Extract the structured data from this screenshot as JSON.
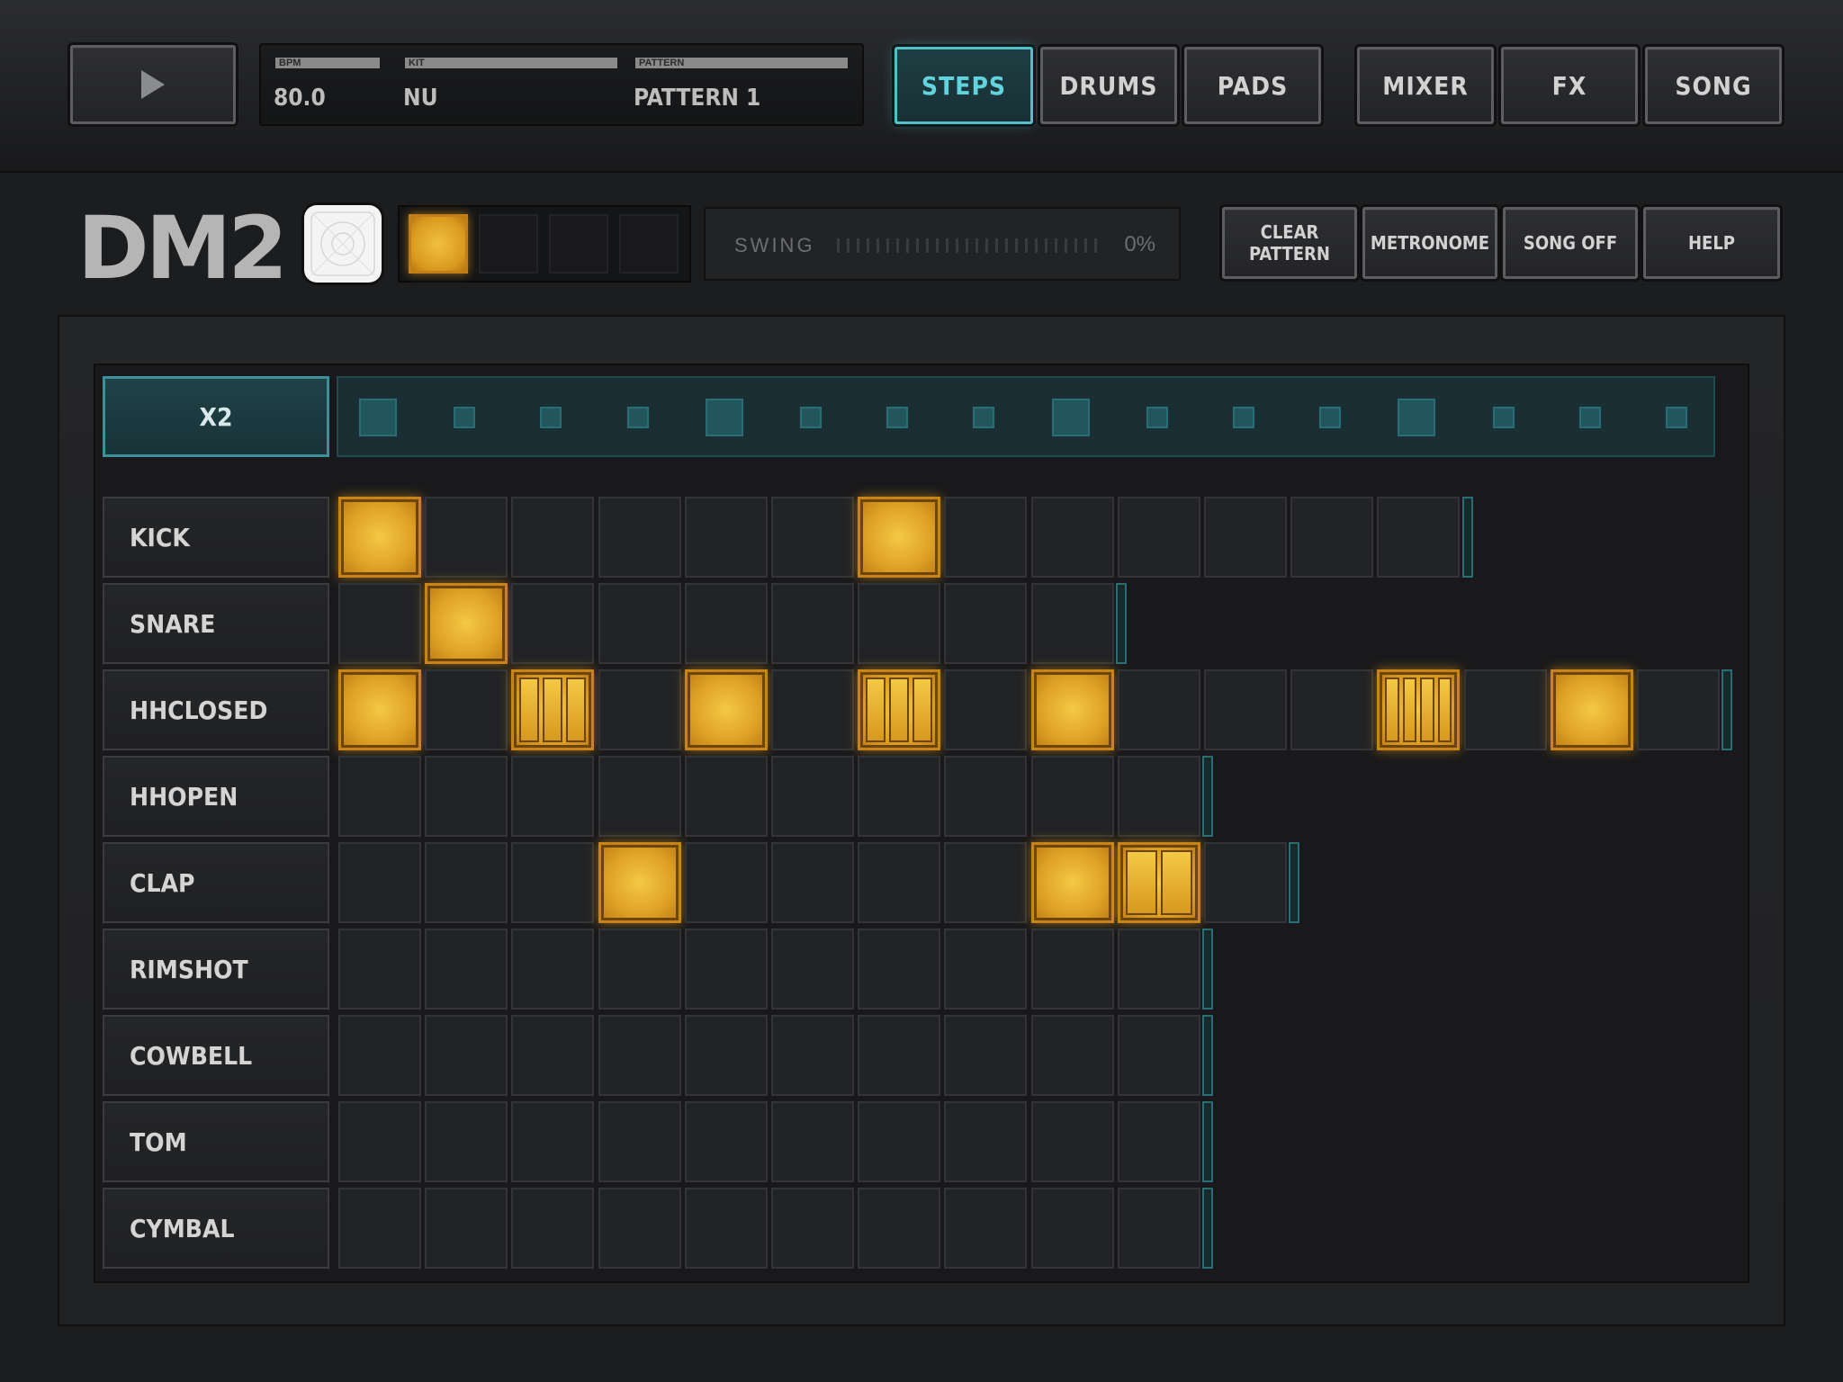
{
  "transport": {
    "bpm_label": "BPM",
    "bpm": "80.0",
    "kit_label": "KIT",
    "kit": "NU",
    "pattern_label": "PATTERN",
    "pattern": "PATTERN 1"
  },
  "nav": {
    "tabs": [
      "STEPS",
      "DRUMS",
      "PADS"
    ],
    "active_tab": "STEPS",
    "right_tabs": [
      "MIXER",
      "FX",
      "SONG"
    ]
  },
  "logo": "DM2",
  "pattern_slots": {
    "count": 4,
    "active_index": 0
  },
  "swing": {
    "label": "SWING",
    "value": "0%"
  },
  "actions": {
    "clear_pattern": "CLEAR PATTERN",
    "metronome": "METRONOME",
    "song_off": "SONG OFF",
    "help": "HELP"
  },
  "multiplier_label": "X2",
  "steps_per_row": 16,
  "colors": {
    "accent": "#53c0c9",
    "step_on": "#e8ac2a"
  },
  "tracks": [
    {
      "name": "KICK",
      "length": 13,
      "steps": [
        {
          "i": 0,
          "sub": 1
        },
        {
          "i": 6,
          "sub": 1
        }
      ]
    },
    {
      "name": "SNARE",
      "length": 9,
      "steps": [
        {
          "i": 1,
          "sub": 1
        }
      ]
    },
    {
      "name": "HHCLOSED",
      "length": 16,
      "steps": [
        {
          "i": 0,
          "sub": 1
        },
        {
          "i": 2,
          "sub": 3
        },
        {
          "i": 4,
          "sub": 1
        },
        {
          "i": 6,
          "sub": 3
        },
        {
          "i": 8,
          "sub": 1
        },
        {
          "i": 12,
          "sub": 4
        },
        {
          "i": 14,
          "sub": 1
        }
      ]
    },
    {
      "name": "HHOPEN",
      "length": 10,
      "steps": []
    },
    {
      "name": "CLAP",
      "length": 11,
      "steps": [
        {
          "i": 3,
          "sub": 1
        },
        {
          "i": 8,
          "sub": 1
        },
        {
          "i": 9,
          "sub": 2
        }
      ]
    },
    {
      "name": "RIMSHOT",
      "length": 10,
      "steps": []
    },
    {
      "name": "COWBELL",
      "length": 10,
      "steps": []
    },
    {
      "name": "TOM",
      "length": 10,
      "steps": []
    },
    {
      "name": "CYMBAL",
      "length": 10,
      "steps": []
    }
  ]
}
